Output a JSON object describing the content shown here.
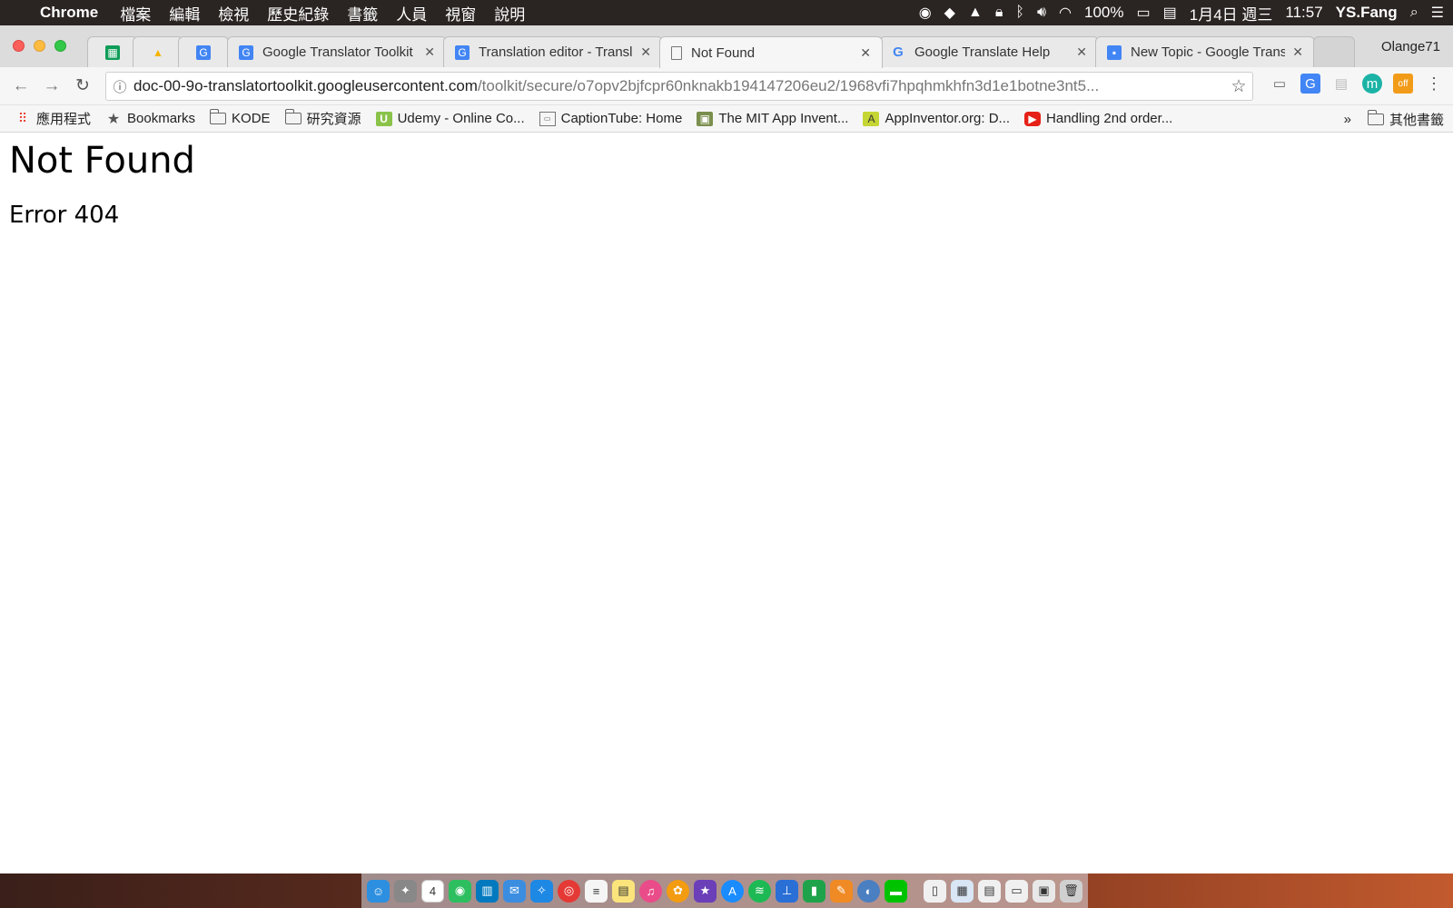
{
  "menubar": {
    "app_name": "Chrome",
    "menus": [
      "檔案",
      "編輯",
      "檢視",
      "歷史紀錄",
      "書籤",
      "人員",
      "視窗",
      "說明"
    ],
    "battery": "100%",
    "date": "1月4日 週三",
    "time": "11:57",
    "user": "YS.Fang"
  },
  "tabs": {
    "items": [
      {
        "title": "",
        "icon": "sheets-icon",
        "pinned": true
      },
      {
        "title": "",
        "icon": "drive-icon",
        "pinned": true
      },
      {
        "title": "",
        "icon": "translate-icon",
        "pinned": true
      },
      {
        "title": "Google Translator Toolkit",
        "icon": "translate-icon"
      },
      {
        "title": "Translation editor - Translator Toolkit",
        "icon": "translate-icon"
      },
      {
        "title": "Not Found",
        "icon": "page-icon",
        "active": true
      },
      {
        "title": "Google Translate Help",
        "icon": "google-icon"
      },
      {
        "title": "New Topic - Google Translate",
        "icon": "forum-icon"
      }
    ],
    "profile": "Olange71"
  },
  "omnibox": {
    "host": "doc-00-9o-translatortoolkit.googleusercontent.com",
    "path": "/toolkit/secure/o7opv2bjfcpr60nknakb194147206eu2/1968vfi7hpqhmkhfn3d1e1botne3nt5..."
  },
  "bookmarks": {
    "items": [
      {
        "label": "應用程式",
        "icon": "apps-grid-icon"
      },
      {
        "label": "Bookmarks",
        "icon": "star-icon"
      },
      {
        "label": "KODE",
        "icon": "folder-icon"
      },
      {
        "label": "研究資源",
        "icon": "folder-icon"
      },
      {
        "label": "Udemy - Online Co...",
        "icon": "udemy-icon"
      },
      {
        "label": "CaptionTube: Home",
        "icon": "caption-icon"
      },
      {
        "label": "The MIT App Invent...",
        "icon": "mit-icon"
      },
      {
        "label": "AppInventor.org: D...",
        "icon": "appinventor-icon"
      },
      {
        "label": "Handling 2nd order...",
        "icon": "youtube-icon"
      }
    ],
    "overflow": "»",
    "other": "其他書籤"
  },
  "page": {
    "heading": "Not Found",
    "message": "Error 404"
  },
  "colors": {
    "menubar_bg": "#2a2422",
    "tabstrip_bg": "#dcdcdc",
    "toolbar_bg": "#f6f6f6"
  }
}
